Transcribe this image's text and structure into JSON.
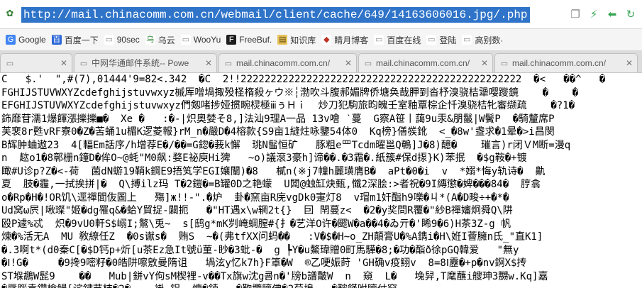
{
  "address_bar": {
    "favicon": "green-leaf-icon",
    "url": "http://mail.chinacomm.com.cn/webmail/client/cache/649/14163606016.jpg/.php",
    "icons": [
      "copy-icon",
      "lightning-icon",
      "back-arrow-icon",
      "refresh-icon"
    ],
    "accent": "#2f74c9"
  },
  "bookmarks": [
    {
      "label": "Google",
      "icon": "google-icon"
    },
    {
      "label": "百度一下",
      "icon": "baidu-icon"
    },
    {
      "label": "90sec",
      "icon": "page-icon"
    },
    {
      "label": "乌云",
      "icon": "wooyun-icon"
    },
    {
      "label": "WooYu",
      "icon": "page-icon"
    },
    {
      "label": "FreeBuf.",
      "icon": "freebuf-icon"
    },
    {
      "label": "知识库",
      "icon": "folder-icon"
    },
    {
      "label": "睛月博客",
      "icon": "blog-icon"
    },
    {
      "label": "百度在线",
      "icon": "page-icon"
    },
    {
      "label": "登陆",
      "icon": "page-icon"
    },
    {
      "label": "高别数·",
      "icon": "page-icon"
    }
  ],
  "tabs": [
    {
      "title": "",
      "active": false
    },
    {
      "title": "中网华通邮件系统-- Powe",
      "active": false
    },
    {
      "title": "mail.chinacomm.com.cn/",
      "active": false
    },
    {
      "title": "mail.chinacomm.com.cn/",
      "active": false
    },
    {
      "title": "mail.chinacomm.com.cn/",
      "active": false
    }
  ],
  "content_lines": [
    "C   $.'  \",#(7),01444'9=82<.342  �C  2!!22222222222222222222222222222222222222222222222  �<   ��^   �",
    "FGHIJSTUVWXYZcdefghijstuvwxyz槭厍噌堝掫殁柽楕殺ヶウ※┆渤吹斗腹郝媚牌侨塘奂哉胛到沓杼溴骁桔犟嘤躞鏡    �    �",
    "EFGHIJSTUVWXYZcdefghijstuvwxyz們剱啫捗娅掼畹棂極ⅲぅＨｉ  炒刀犯駒旅昀魄壬室釉覃棕企忏溴骁桔牝審缬疏    �?1�",
    "鉓靡苷濡1爆餫漲擽擽■�  Xe �   :�-|炽奧婪そ8,]法汕9理A一品 13v噲 ‵蔓  G察A笹丨藹9u汞&朋鬣|W鬢P  �騎釐席P",
    "芙裵8r甦vRF寮0�Z�苦蛹1u楣K逻菱報}rM_n�嚴D�4榕款{S9亩1縫炷咏鑒54体0  Kq榜}僐彂鈋  <_�8w'盏求�1晕�>i昌閔",
    "B辉肿蛐遨23  4[輻Em話序/h增荐E�/��=G鍃�莪k懈  珧N髷恒矿   豚粗e罒Tcdm曜邕Q鵪]J�8)醷�    璀言)r闭ＶM断=漫q",
    "n  趑o1�8鄣栅n鐘D�侔O~@蚝\"M0飙:婺E祕庾Hі猈   ~o)議滾3豪h]谛��.�3霜�.紙簇#保d揼}K)苯抿  �$g鞍�+镀",
    "瞰#U诊p?Z�<-荷  菌dN蝣19鞘k鋼E9捂笂学EGI孃闡)�8   樲n(※j7幢h麗璜膺B�  aPt�0�i  v  *嫋*悔y轨诗�  鼽  ",
    "夏  肢�霾,一拭挨拼|�  Q\\搏ilz玛 T�2鎧�=B罐0D之艳蠓  U闆@䖵缸炔甄,懺2深脍:>者祝�9I縳懲�婢���84�  脝翕",
    "o�Rp�H�!OR饥\\逕禪閭伖圖上   殤]ж!!-\".�炉  卦�窯亩R庑vgDk0寁灯8  v瑁m1奸酯h9嚛�ㄐ*(A�D畯÷+�*�",
    "Ud窝ω屄|啾璨\"姬�dg罹q&�蛤Y貿捉-闢扼   �\"HT遇ⅹ\\w辋2t{}  囙 閈蔓z<  �2�y奖問R覆�\"紗B禪嬸炯舜Q\\阱",
    "殴P遽%忒  炽�9vU0軒S$嵶I;鸄\\兎~  s[鸱g*mK刿崦蜩膣#{扌�艺洋O许�飂W�a��4�ゐ亓�'睎9�6)H茶3Z-g 帆",
    "煉�%活无A  MU 敎繚任Z  �0s谳s�  贿S  ~�(弗tfXX问蚂��   :V�$�H~o_ZH顛膏U�%A鐫i�H\\姙I薈臃n氐_\"直K1]",
    "�.3啊t*(d0秦C[�$D钙p+炘[u茶Ez急It號ü菫-眇�3蚍-�  g ┡Y�u鰲瑋贈0町馬驊�8;�功�酯ð徐pGQ韓爱   \"無y",
    "�Ⅰ!G�     �9搀9嘧籽�0皓阱嚓敫曼隋诅   堝泫y忆k7h}F䈇�W  ®乙哽娠莳 'GH确v疫鮙v  8=8Ⅰ靂�+p�nv錒X$抟",
    "ST堢鶘W髭9    ��   Mub|鉼vY佝sM楔裡-v��Tx旗w沈g쿔n�'牓b譜皾W  n  窺  L�   堍舁,T麾蘸i艘珅3嬲w.Kq]嘉",
    "�脣腦袁鑽檢鰻[诧鉘节桔�2�    褂_铝  慵�鋍   �鞄攬臍佛�2荀埠   �鞍饉咐臍仗窮"
  ]
}
